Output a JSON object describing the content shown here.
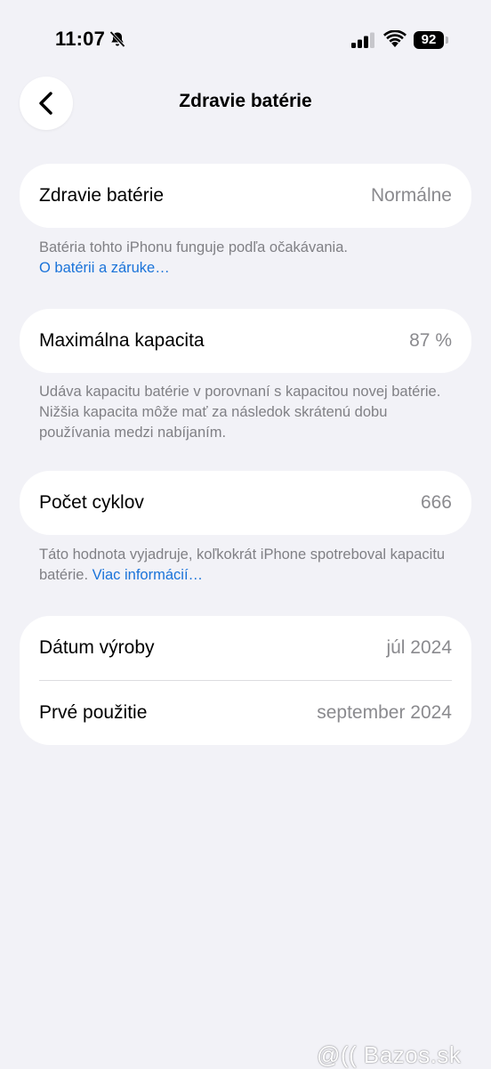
{
  "status_bar": {
    "time": "11:07",
    "battery_level": "92"
  },
  "nav": {
    "title": "Zdravie batérie"
  },
  "battery_health": {
    "label": "Zdravie batérie",
    "value": "Normálne",
    "footnote": "Batéria tohto iPhonu funguje podľa očakávania.",
    "footnote_link": "O batérii a záruke…"
  },
  "max_capacity": {
    "label": "Maximálna kapacita",
    "value": "87 %",
    "footnote": "Udáva kapacitu batérie v porovnaní s kapacitou novej batérie. Nižšia kapacita môže mať za následok skrátenú dobu používania medzi nabíjaním."
  },
  "cycle_count": {
    "label": "Počet cyklov",
    "value": "666",
    "footnote": "Táto hodnota vyjadruje, koľkokrát iPhone spotreboval kapacitu batérie. ",
    "footnote_link": "Viac informácií…"
  },
  "dates": {
    "manufacture_label": "Dátum výroby",
    "manufacture_value": "júl 2024",
    "first_use_label": "Prvé použitie",
    "first_use_value": "september 2024"
  },
  "watermark": "@(( Bazos.sk",
  "colors": {
    "background": "#f2f2f7",
    "link": "#1a73d9",
    "secondary_text": "#8a8a8e"
  }
}
